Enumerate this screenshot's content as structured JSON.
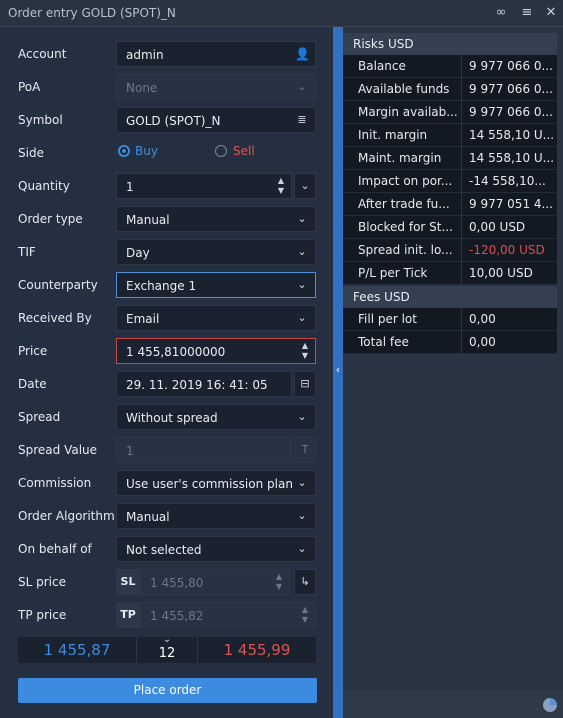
{
  "window": {
    "title": "Order entry GOLD (SPOT)_N",
    "icons": [
      "link-icon",
      "list-menu-icon",
      "close-icon"
    ]
  },
  "form": {
    "account": {
      "label": "Account",
      "value": "admin"
    },
    "poa": {
      "label": "PoA",
      "value": "None"
    },
    "symbol": {
      "label": "Symbol",
      "value": "GOLD (SPOT)_N"
    },
    "side": {
      "label": "Side",
      "buy": "Buy",
      "sell": "Sell",
      "selected": "Buy"
    },
    "quantity": {
      "label": "Quantity",
      "value": "1"
    },
    "order_type": {
      "label": "Order type",
      "value": "Manual"
    },
    "tif": {
      "label": "TIF",
      "value": "Day"
    },
    "counterparty": {
      "label": "Counterparty",
      "value": "Exchange 1"
    },
    "received_by": {
      "label": "Received By",
      "value": "Email"
    },
    "price": {
      "label": "Price",
      "value": "1 455,81000000"
    },
    "date": {
      "label": "Date",
      "value": "29. 11. 2019  16: 41: 05"
    },
    "spread": {
      "label": "Spread",
      "value": "Without spread"
    },
    "spread_value": {
      "label": "Spread Value",
      "value": "1"
    },
    "commission": {
      "label": "Commission",
      "value": "Use user's commission plan"
    },
    "order_algorithm": {
      "label": "Order Algorithm",
      "value": "Manual"
    },
    "on_behalf_of": {
      "label": "On behalf of",
      "value": "Not selected"
    },
    "sl_price": {
      "label": "SL price",
      "tag": "SL",
      "value": "1 455,80"
    },
    "tp_price": {
      "label": "TP price",
      "tag": "TP",
      "value": "1 455,82"
    }
  },
  "quote": {
    "bid": "1 455,87",
    "spread": "12",
    "ask": "1 455,99"
  },
  "place_order": "Place order",
  "risks": {
    "title": "Risks USD",
    "rows": [
      {
        "k": "Balance",
        "v": "9 977 066 0..."
      },
      {
        "k": "Available  funds",
        "v": "9 977 066 0..."
      },
      {
        "k": "Margin availab...",
        "v": "9 977 066 0..."
      },
      {
        "k": "Init. margin",
        "v": "14 558,10 U..."
      },
      {
        "k": "Maint. margin",
        "v": "14 558,10 U..."
      },
      {
        "k": "Impact on por...",
        "v": "-14 558,10..."
      },
      {
        "k": "After trade fu...",
        "v": "9 977 051 4..."
      },
      {
        "k": "Blocked for St...",
        "v": "0,00 USD"
      },
      {
        "k": "Spread init. lo...",
        "v": "-120,00 USD"
      },
      {
        "k": "P/L per Tick",
        "v": "10,00 USD"
      }
    ]
  },
  "fees": {
    "title": "Fees USD",
    "rows": [
      {
        "k": "Fill per lot",
        "v": "0,00"
      },
      {
        "k": "Total fee",
        "v": "0,00"
      }
    ]
  },
  "colors": {
    "accent": "#3d8be0",
    "negative": "#e34a4a",
    "bid": "#3d8be0",
    "ask": "#e05252"
  }
}
